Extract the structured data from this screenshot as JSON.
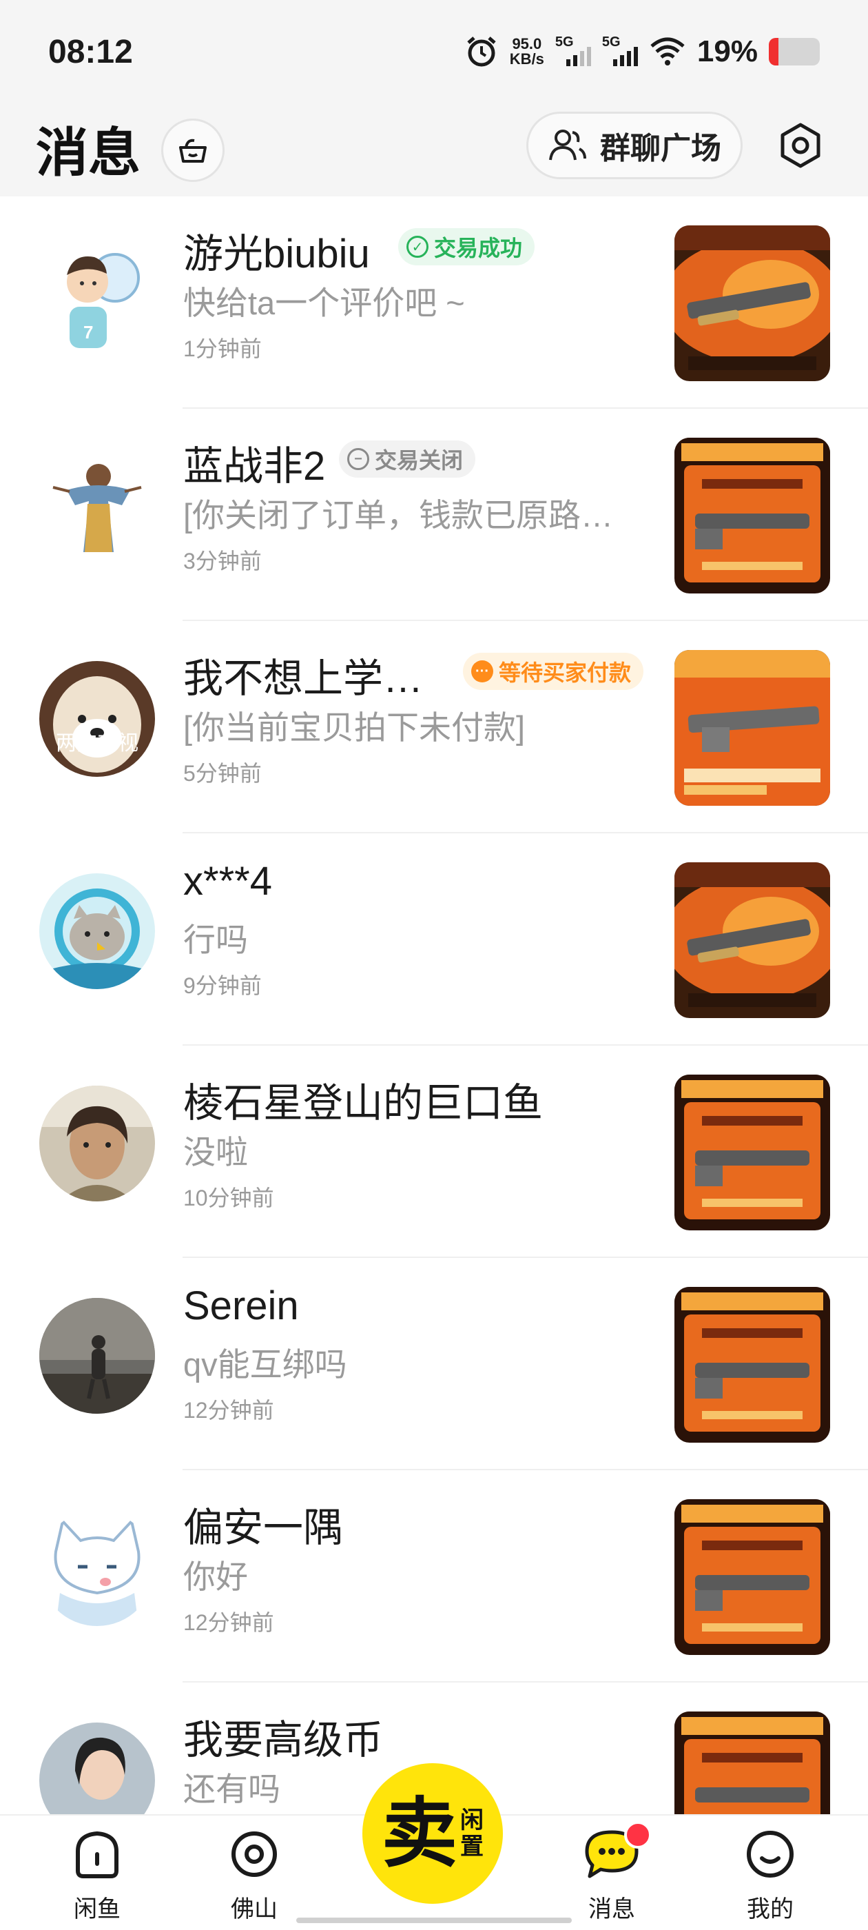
{
  "status_bar": {
    "time": "08:12",
    "net_speed_value": "95.0",
    "net_speed_unit": "KB/s",
    "sim1": "5G",
    "sim2": "5G",
    "battery_percent_text": "19%",
    "battery_level": 0.19
  },
  "header": {
    "title": "消息",
    "group_chat_label": "群聊广场"
  },
  "conversations": [
    {
      "name": "游光biubiu",
      "badge": "交易成功",
      "badge_type": "success",
      "message": "快给ta一个评价吧 ~",
      "time": "1分钟前"
    },
    {
      "name": "蓝战非2",
      "badge": "交易关闭",
      "badge_type": "closed",
      "message": "[你关闭了订单，钱款已原路…",
      "time": "3分钟前"
    },
    {
      "name": "我不想上学…",
      "badge": "等待买家付款",
      "badge_type": "waiting",
      "message": "[你当前宝贝拍下未付款]",
      "time": "5分钟前",
      "avatar_text": "两狗对视"
    },
    {
      "name": "x***4",
      "message": "行吗",
      "time": "9分钟前"
    },
    {
      "name": "棱石星登山的巨口鱼",
      "message": "没啦",
      "time": "10分钟前"
    },
    {
      "name": "Serein",
      "message": "qv能互绑吗",
      "time": "12分钟前"
    },
    {
      "name": "偏安一隅",
      "message": "你好",
      "time": "12分钟前"
    },
    {
      "name": "我要高级币",
      "message": "还有吗",
      "time": ""
    }
  ],
  "tab_bar": {
    "tabs": [
      {
        "label": "闲鱼",
        "icon": "home-icon"
      },
      {
        "label": "佛山",
        "icon": "location-icon"
      },
      {
        "label": "消息",
        "icon": "message-icon"
      },
      {
        "label": "我的",
        "icon": "profile-icon"
      }
    ],
    "sell_big": "卖",
    "sell_small_1": "闲",
    "sell_small_2": "置"
  },
  "colors": {
    "accent_yellow": "#ffe40b",
    "success_green": "#27b35a",
    "waiting_orange": "#ff8c1a",
    "notification_red": "#ff3344"
  }
}
